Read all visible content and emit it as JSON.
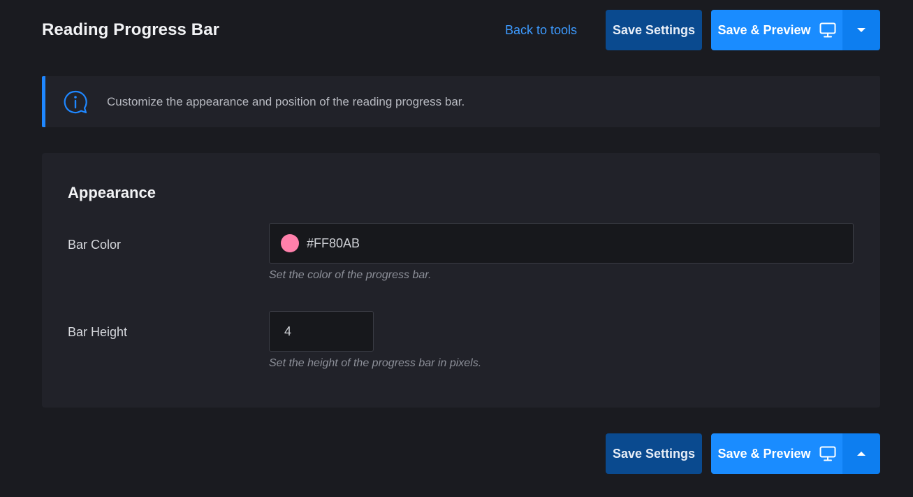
{
  "header": {
    "title": "Reading Progress Bar",
    "back_link": "Back to tools",
    "save_label": "Save Settings",
    "preview_label": "Save & Preview"
  },
  "notice": {
    "text": "Customize the appearance and position of the reading progress bar.",
    "icon": "info-icon"
  },
  "appearance": {
    "title": "Appearance",
    "bar_color": {
      "label": "Bar Color",
      "value": "#FF80AB",
      "help": "Set the color of the progress bar."
    },
    "bar_height": {
      "label": "Bar Height",
      "value": "4",
      "help": "Set the height of the progress bar in pixels."
    }
  },
  "footer": {
    "save_label": "Save Settings",
    "preview_label": "Save & Preview"
  },
  "colors": {
    "accent": "#1a8cff",
    "save_button": "#0a4a8f",
    "swatch": "#FF80AB"
  }
}
